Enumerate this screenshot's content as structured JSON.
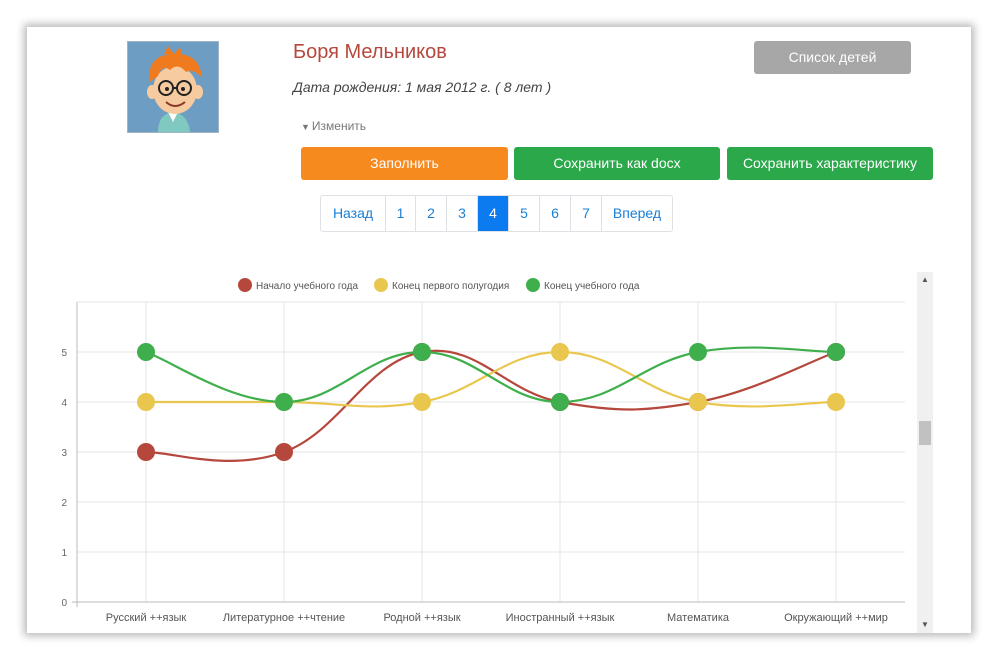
{
  "profile": {
    "name": "Боря Мельников",
    "birth": "Дата рождения: 1 мая 2012 г. ( 8 лет )",
    "edit_label": "Изменить"
  },
  "buttons": {
    "children_list": "Список детей",
    "fill": "Заполнить",
    "save_docx": "Сохранить как docx",
    "save_characteristic": "Сохранить характеристику"
  },
  "pagination": {
    "prev": "Назад",
    "pages": [
      "1",
      "2",
      "3",
      "4",
      "5",
      "6",
      "7"
    ],
    "active": "4",
    "next": "Вперед"
  },
  "colors": {
    "start": "#b5473d",
    "mid": "#e9c74f",
    "end": "#3eaf4c"
  },
  "chart_data": {
    "type": "line",
    "categories": [
      "Русский ++язык",
      "Литературное ++чтение",
      "Родной ++язык",
      "Иностранный ++язык",
      "Математика",
      "Окружающий ++мир"
    ],
    "series": [
      {
        "name": "Начало учебного года",
        "values": [
          3,
          3,
          5,
          4,
          4,
          5
        ],
        "color": "#b5473d"
      },
      {
        "name": "Конец первого полугодия",
        "values": [
          4,
          4,
          4,
          5,
          4,
          4
        ],
        "color": "#e9c74f"
      },
      {
        "name": "Конец учебного года",
        "values": [
          5,
          4,
          5,
          4,
          5,
          5
        ],
        "color": "#3eaf4c"
      }
    ],
    "yticks": [
      "0",
      "1",
      "2",
      "3",
      "4",
      "5"
    ],
    "ylim": [
      0,
      6
    ],
    "grid": true,
    "legend": "top",
    "smooth": true
  }
}
